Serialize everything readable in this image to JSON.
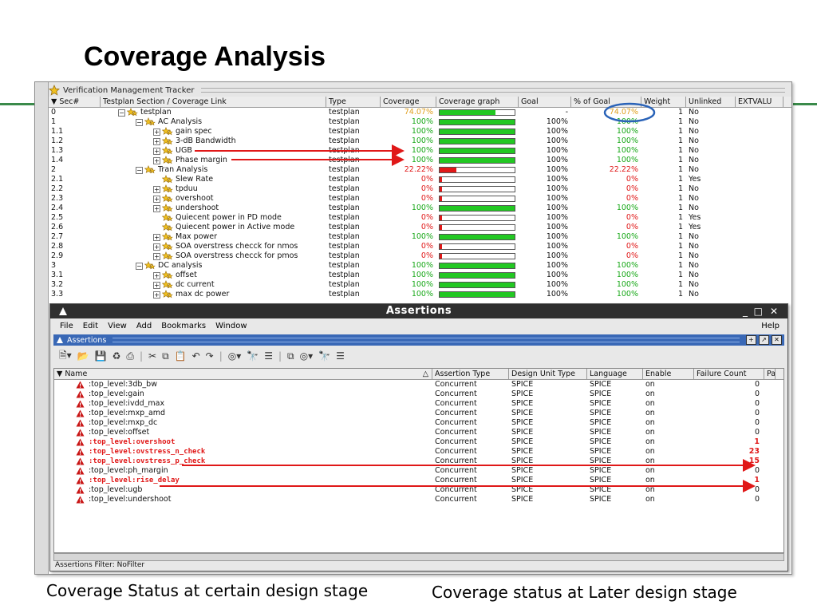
{
  "slide": {
    "title": "Coverage Analysis",
    "caption_left": "Coverage Status at certain design stage",
    "caption_right": "Coverage status at Later design stage"
  },
  "vmt": {
    "window_title": "Verification Management Tracker",
    "columns": [
      "Sec#",
      "Testplan Section / Coverage Link",
      "Type",
      "Coverage",
      "Coverage graph",
      "Goal",
      "% of Goal",
      "Weight",
      "Unlinked",
      "EXTVALU"
    ],
    "rows": [
      {
        "sec": "0",
        "name": "testplan",
        "level": 0,
        "expander": "minus",
        "type": "testplan",
        "coverage": "74.07%",
        "coverage_value": 74.07,
        "goal": "-",
        "pct": "74.07%",
        "weight": "1",
        "unlinked": "No",
        "tone": "orange"
      },
      {
        "sec": "1",
        "name": "AC Analysis",
        "level": 1,
        "expander": "minus",
        "type": "testplan",
        "coverage": "100%",
        "coverage_value": 100,
        "goal": "100%",
        "pct": "100%",
        "weight": "1",
        "unlinked": "No",
        "tone": "green"
      },
      {
        "sec": "1.1",
        "name": "gain spec",
        "level": 2,
        "expander": "plus",
        "type": "testplan",
        "coverage": "100%",
        "coverage_value": 100,
        "goal": "100%",
        "pct": "100%",
        "weight": "1",
        "unlinked": "No",
        "tone": "green"
      },
      {
        "sec": "1.2",
        "name": "3-dB Bandwidth",
        "level": 2,
        "expander": "plus",
        "type": "testplan",
        "coverage": "100%",
        "coverage_value": 100,
        "goal": "100%",
        "pct": "100%",
        "weight": "1",
        "unlinked": "No",
        "tone": "green"
      },
      {
        "sec": "1.3",
        "name": "UGB",
        "level": 2,
        "expander": "plus",
        "type": "testplan",
        "coverage": "100%",
        "coverage_value": 100,
        "goal": "100%",
        "pct": "100%",
        "weight": "1",
        "unlinked": "No",
        "tone": "green"
      },
      {
        "sec": "1.4",
        "name": "Phase margin",
        "level": 2,
        "expander": "plus",
        "type": "testplan",
        "coverage": "100%",
        "coverage_value": 100,
        "goal": "100%",
        "pct": "100%",
        "weight": "1",
        "unlinked": "No",
        "tone": "green"
      },
      {
        "sec": "2",
        "name": "Tran Analysis",
        "level": 1,
        "expander": "minus",
        "type": "testplan",
        "coverage": "22.22%",
        "coverage_value": 22.22,
        "goal": "100%",
        "pct": "22.22%",
        "weight": "1",
        "unlinked": "No",
        "tone": "red"
      },
      {
        "sec": "2.1",
        "name": "Slew Rate",
        "level": 2,
        "expander": "none",
        "type": "testplan",
        "coverage": "0%",
        "coverage_value": 0,
        "goal": "100%",
        "pct": "0%",
        "weight": "1",
        "unlinked": "Yes",
        "tone": "red"
      },
      {
        "sec": "2.2",
        "name": "tpduu",
        "level": 2,
        "expander": "plus",
        "type": "testplan",
        "coverage": "0%",
        "coverage_value": 0,
        "goal": "100%",
        "pct": "0%",
        "weight": "1",
        "unlinked": "No",
        "tone": "red"
      },
      {
        "sec": "2.3",
        "name": "overshoot",
        "level": 2,
        "expander": "plus",
        "type": "testplan",
        "coverage": "0%",
        "coverage_value": 0,
        "goal": "100%",
        "pct": "0%",
        "weight": "1",
        "unlinked": "No",
        "tone": "red"
      },
      {
        "sec": "2.4",
        "name": "undershoot",
        "level": 2,
        "expander": "plus",
        "type": "testplan",
        "coverage": "100%",
        "coverage_value": 100,
        "goal": "100%",
        "pct": "100%",
        "weight": "1",
        "unlinked": "No",
        "tone": "green"
      },
      {
        "sec": "2.5",
        "name": "Quiecent power in PD mode",
        "level": 2,
        "expander": "none",
        "type": "testplan",
        "coverage": "0%",
        "coverage_value": 0,
        "goal": "100%",
        "pct": "0%",
        "weight": "1",
        "unlinked": "Yes",
        "tone": "red"
      },
      {
        "sec": "2.6",
        "name": "Quiecent power in Active mode",
        "level": 2,
        "expander": "none",
        "type": "testplan",
        "coverage": "0%",
        "coverage_value": 0,
        "goal": "100%",
        "pct": "0%",
        "weight": "1",
        "unlinked": "Yes",
        "tone": "red"
      },
      {
        "sec": "2.7",
        "name": "Max power",
        "level": 2,
        "expander": "plus",
        "type": "testplan",
        "coverage": "100%",
        "coverage_value": 100,
        "goal": "100%",
        "pct": "100%",
        "weight": "1",
        "unlinked": "No",
        "tone": "green"
      },
      {
        "sec": "2.8",
        "name": "SOA overstress checck for nmos",
        "level": 2,
        "expander": "plus",
        "type": "testplan",
        "coverage": "0%",
        "coverage_value": 0,
        "goal": "100%",
        "pct": "0%",
        "weight": "1",
        "unlinked": "No",
        "tone": "red"
      },
      {
        "sec": "2.9",
        "name": "SOA overstress checck for pmos",
        "level": 2,
        "expander": "plus",
        "type": "testplan",
        "coverage": "0%",
        "coverage_value": 0,
        "goal": "100%",
        "pct": "0%",
        "weight": "1",
        "unlinked": "No",
        "tone": "red"
      },
      {
        "sec": "3",
        "name": "DC analysis",
        "level": 1,
        "expander": "minus",
        "type": "testplan",
        "coverage": "100%",
        "coverage_value": 100,
        "goal": "100%",
        "pct": "100%",
        "weight": "1",
        "unlinked": "No",
        "tone": "green"
      },
      {
        "sec": "3.1",
        "name": "offset",
        "level": 2,
        "expander": "plus",
        "type": "testplan",
        "coverage": "100%",
        "coverage_value": 100,
        "goal": "100%",
        "pct": "100%",
        "weight": "1",
        "unlinked": "No",
        "tone": "green"
      },
      {
        "sec": "3.2",
        "name": "dc current",
        "level": 2,
        "expander": "plus",
        "type": "testplan",
        "coverage": "100%",
        "coverage_value": 100,
        "goal": "100%",
        "pct": "100%",
        "weight": "1",
        "unlinked": "No",
        "tone": "green"
      },
      {
        "sec": "3.3",
        "name": "max dc power",
        "level": 2,
        "expander": "plus",
        "type": "testplan",
        "coverage": "100%",
        "coverage_value": 100,
        "goal": "100%",
        "pct": "100%",
        "weight": "1",
        "unlinked": "No",
        "tone": "green"
      }
    ]
  },
  "assertions": {
    "window_title": "Assertions",
    "menu": [
      "File",
      "Edit",
      "View",
      "Add",
      "Bookmarks",
      "Window"
    ],
    "help": "Help",
    "pane_title": "Assertions",
    "columns": [
      "Name",
      "Assertion Type",
      "Design Unit Type",
      "Language",
      "Enable",
      "Failure Count",
      "Pa"
    ],
    "rows": [
      {
        "name": ":top_level:3db_bw",
        "type": "Concurrent",
        "du": "SPICE",
        "lang": "SPICE",
        "enable": "on",
        "fail": "0",
        "failed": false
      },
      {
        "name": ":top_level:gain",
        "type": "Concurrent",
        "du": "SPICE",
        "lang": "SPICE",
        "enable": "on",
        "fail": "0",
        "failed": false
      },
      {
        "name": ":top_level:ivdd_max",
        "type": "Concurrent",
        "du": "SPICE",
        "lang": "SPICE",
        "enable": "on",
        "fail": "0",
        "failed": false
      },
      {
        "name": ":top_level:mxp_amd",
        "type": "Concurrent",
        "du": "SPICE",
        "lang": "SPICE",
        "enable": "on",
        "fail": "0",
        "failed": false
      },
      {
        "name": ":top_level:mxp_dc",
        "type": "Concurrent",
        "du": "SPICE",
        "lang": "SPICE",
        "enable": "on",
        "fail": "0",
        "failed": false
      },
      {
        "name": ":top_level:offset",
        "type": "Concurrent",
        "du": "SPICE",
        "lang": "SPICE",
        "enable": "on",
        "fail": "0",
        "failed": false
      },
      {
        "name": ":top_level:overshoot",
        "type": "Concurrent",
        "du": "SPICE",
        "lang": "SPICE",
        "enable": "on",
        "fail": "1",
        "failed": true
      },
      {
        "name": ":top_level:ovstress_n_check",
        "type": "Concurrent",
        "du": "SPICE",
        "lang": "SPICE",
        "enable": "on",
        "fail": "23",
        "failed": true
      },
      {
        "name": ":top_level:ovstress_p_check",
        "type": "Concurrent",
        "du": "SPICE",
        "lang": "SPICE",
        "enable": "on",
        "fail": "15",
        "failed": true
      },
      {
        "name": ":top_level:ph_margin",
        "type": "Concurrent",
        "du": "SPICE",
        "lang": "SPICE",
        "enable": "on",
        "fail": "0",
        "failed": false
      },
      {
        "name": ":top_level:rise_delay",
        "type": "Concurrent",
        "du": "SPICE",
        "lang": "SPICE",
        "enable": "on",
        "fail": "1",
        "failed": true
      },
      {
        "name": ":top_level:ugb",
        "type": "Concurrent",
        "du": "SPICE",
        "lang": "SPICE",
        "enable": "on",
        "fail": "0",
        "failed": false
      },
      {
        "name": ":top_level:undershoot",
        "type": "Concurrent",
        "du": "SPICE",
        "lang": "SPICE",
        "enable": "on",
        "fail": "0",
        "failed": false
      }
    ],
    "filter_status": "Assertions Filter: NoFilter"
  },
  "colors": {
    "accent_line": "#3a8a4a",
    "bar_green": "#22c822",
    "bar_red": "#e01818",
    "annotation_arrow": "#e01818",
    "annotation_circle": "#2a63b8",
    "title_bar": "#2f2f2f",
    "pane_bar": "#3968b6"
  }
}
